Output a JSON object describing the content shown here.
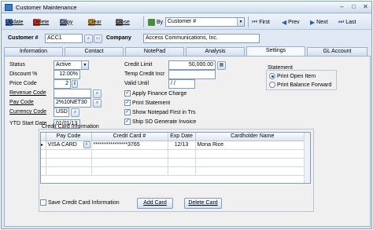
{
  "window": {
    "title": "Customer Maintenance"
  },
  "toolbar": {
    "update": "Update",
    "delete": "Delete",
    "copy": "Copy",
    "clear": "Clear",
    "close": "Close",
    "by_label": "By",
    "by_value": "Customer #",
    "first": "First",
    "prev": "Prev",
    "next": "Next",
    "last": "Last"
  },
  "header": {
    "customer_label": "Customer #",
    "customer_value": "ACC1",
    "company_label": "Company",
    "company_value": "Access Communications, Inc."
  },
  "tabs": [
    "Information",
    "Contact",
    "NotePad",
    "Analysis",
    "Settings",
    "GL Account"
  ],
  "active_tab": "Settings",
  "settings": {
    "status_label": "Status",
    "status_value": "Active",
    "discount_label": "Discount %",
    "discount_value": "12.00%",
    "price_code_label": "Price Code",
    "price_code_value": "2",
    "revenue_code_label": "Revenue Code",
    "revenue_code_value": "",
    "pay_code_label": "Pay Code",
    "pay_code_value": "2%10NET30",
    "currency_code_label": "Currency Code",
    "currency_code_value": "USD",
    "ytd_start_label": "YTD Start Date",
    "ytd_start_value": "01/01/13",
    "credit_limit_label": "Credit Limit",
    "credit_limit_value": "50,000.00",
    "temp_credit_label": "Temp Credit Incr",
    "temp_credit_value": "",
    "valid_until_label": "Valid Until",
    "valid_until_value": " /  /",
    "checks": [
      {
        "label": "Apply Finance Charge",
        "checked": true
      },
      {
        "label": "Print Statement",
        "checked": true
      },
      {
        "label": "Show Notepad First in Trs",
        "checked": true
      },
      {
        "label": "Ship SO Generate Invoice",
        "checked": true
      }
    ],
    "statement_label": "Statement",
    "statement_options": [
      {
        "label": "Print Open Item",
        "selected": true
      },
      {
        "label": "Print Balance Forward",
        "selected": false
      }
    ]
  },
  "credit_card": {
    "group_label": "Credit Card Information",
    "columns": [
      "Pay Code",
      "Credit Card #",
      "Exp Date",
      "Cardholder Name"
    ],
    "rows": [
      {
        "marker": "▸",
        "pay_code": "VISA CARD",
        "card": "****************3765",
        "exp": "12/13",
        "name": "Mona Rice"
      }
    ],
    "save_label": "Save Credit Card Information",
    "add_label": "Add Card",
    "delete_label": "Delete Card"
  }
}
